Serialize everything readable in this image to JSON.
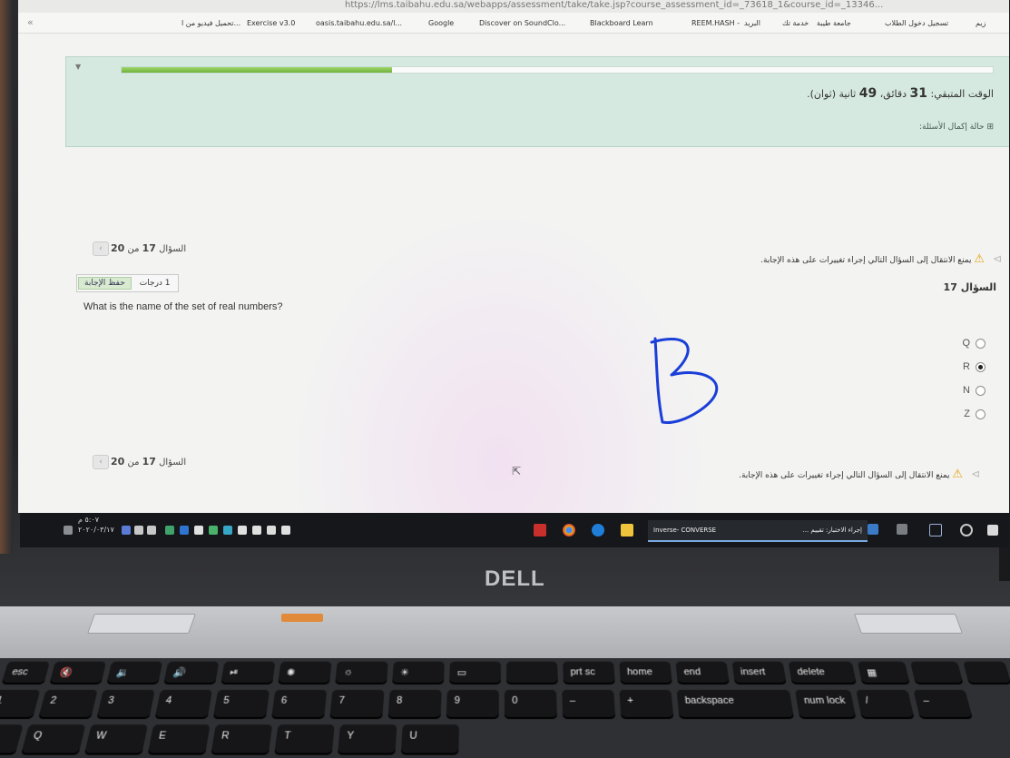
{
  "browser": {
    "url": "https://lms.taibahu.edu.sa/webapps/assessment/take/take.jsp?course_assessment_id=_73618_1&course_id=_13346...",
    "bookmarks": [
      "تحميل فيديو من ا...",
      "Exercise v3.0",
      "oasis.taibahu.edu.sa/l...",
      "Google",
      "Discover on SoundClo...",
      "Blackboard Learn",
      "REEM.HASH -",
      "البريد",
      "خدمة تك",
      "جامعة طيبة",
      "تسجيل دخول الطلاب",
      "زيم"
    ]
  },
  "assessment": {
    "timer_label": "الوقت المتبقي:",
    "timer_minutes": "31",
    "timer_minutes_unit": "دقائق،",
    "timer_seconds": "49",
    "timer_seconds_unit": "ثانية (ثوان).",
    "progress_fraction": 0.31,
    "status_link": "حالة إكمال الأسئلة:",
    "nav_top": {
      "prefix": "السؤال",
      "current": "17",
      "of": "من",
      "total": "20"
    },
    "nav_bottom": {
      "prefix": "السؤال",
      "current": "17",
      "of": "من",
      "total": "20"
    },
    "warning_text": "يمنع الانتقال إلى السؤال التالي إجراء تغييرات على هذه الإجابة.",
    "question_heading": "السؤال 17",
    "points_label": "1 درجات",
    "save_answer": "حفظ الإجابة",
    "question_text": "What is the name of the set of real numbers?",
    "options": [
      {
        "label": "Q",
        "selected": false
      },
      {
        "label": "R",
        "selected": true
      },
      {
        "label": "N",
        "selected": false
      },
      {
        "label": "Z",
        "selected": false
      }
    ],
    "annotation_letter": "B"
  },
  "taskbar": {
    "clock_time": "٥:٠٧ م",
    "clock_date": "٢٠٢٠/٠٣/١٧",
    "app_converse": "Inverse- CONVERSE",
    "app_quiz": "إجراء الاختبار: تقييم ..."
  },
  "laptop": {
    "brand": "DELL",
    "keys": [
      "esc",
      "prt sc",
      "home",
      "end",
      "insert",
      "delete",
      "backspace",
      "num lock",
      "Q",
      "W",
      "E",
      "R",
      "T",
      "Y",
      "U"
    ]
  },
  "colors": {
    "panel_bg": "#d6e9e0",
    "progress_fill": "#7cc043",
    "ink_blue": "#1a3fd8",
    "taskbar_bg": "#15171a"
  }
}
